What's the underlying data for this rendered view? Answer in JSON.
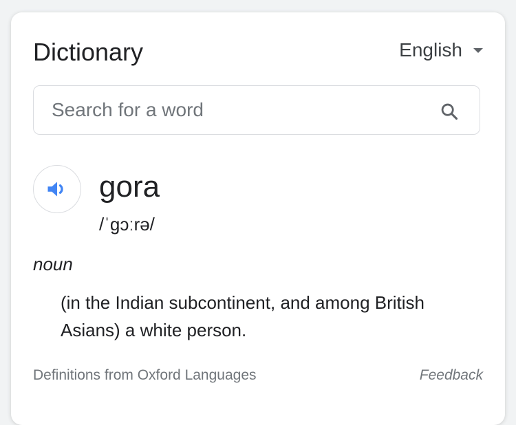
{
  "header": {
    "title": "Dictionary",
    "language": "English"
  },
  "search": {
    "placeholder": "Search for a word",
    "value": ""
  },
  "entry": {
    "word": "gora",
    "pronunciation": "/ˈɡɔːrə/",
    "part_of_speech": "noun",
    "definition": "(in the Indian subcontinent, and among British Asians) a white person."
  },
  "footer": {
    "source": "Definitions from Oxford Languages",
    "feedback": "Feedback"
  },
  "icons": {
    "search": "search-icon",
    "speaker": "speaker-icon",
    "dropdown": "chevron-down-icon"
  },
  "colors": {
    "speaker_accent": "#4285f4",
    "text_primary": "#202124",
    "text_secondary": "#70757a"
  }
}
